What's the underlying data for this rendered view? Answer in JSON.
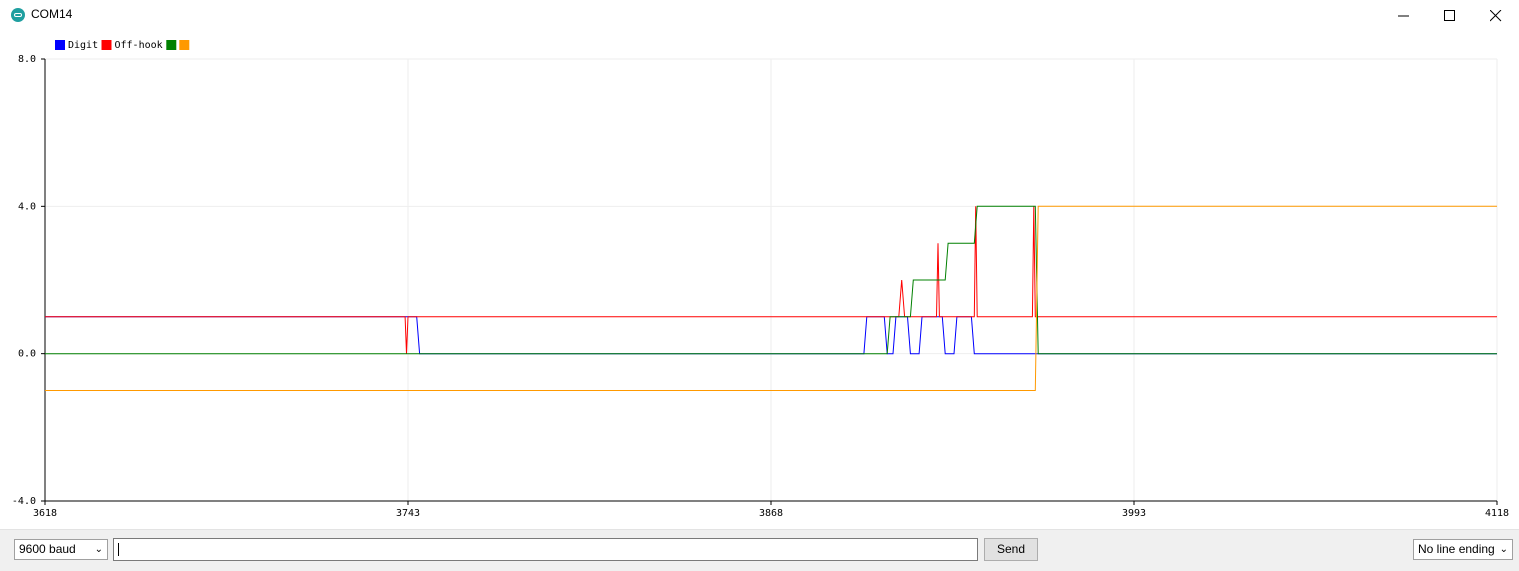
{
  "window": {
    "title": "COM14"
  },
  "chart_data": {
    "type": "line",
    "legend": [
      "Digit",
      "Off-hook",
      "",
      ""
    ],
    "x_ticks": [
      "3618",
      "3743",
      "3868",
      "3993",
      "4118"
    ],
    "y_ticks": [
      "8.0",
      "4.0",
      "0.0",
      "-4.0"
    ],
    "xlim": [
      3618,
      4118
    ],
    "ylim": [
      -4,
      8
    ],
    "grid": true,
    "legend_position": "top-left",
    "series": [
      {
        "name": "Digit",
        "color": "#0000ff",
        "points": [
          [
            3618,
            1
          ],
          [
            3743,
            1
          ],
          [
            3746,
            1
          ],
          [
            3747,
            0
          ],
          [
            3900,
            0
          ],
          [
            3901,
            1
          ],
          [
            3907,
            1
          ],
          [
            3908,
            0
          ],
          [
            3910,
            0
          ],
          [
            3911,
            1
          ],
          [
            3915,
            1
          ],
          [
            3916,
            0
          ],
          [
            3919,
            0
          ],
          [
            3920,
            1
          ],
          [
            3927,
            1
          ],
          [
            3928,
            0
          ],
          [
            3931,
            0
          ],
          [
            3932,
            1
          ],
          [
            3937,
            1
          ],
          [
            3938,
            0
          ],
          [
            4118,
            0
          ]
        ]
      },
      {
        "name": "Off-hook",
        "color": "#ff0000",
        "points": [
          [
            3618,
            1
          ],
          [
            3742,
            1
          ],
          [
            3742.5,
            0
          ],
          [
            3743,
            1
          ],
          [
            3912,
            1
          ],
          [
            3913,
            2
          ],
          [
            3914,
            1
          ],
          [
            3925,
            1
          ],
          [
            3925.5,
            3
          ],
          [
            3926,
            1
          ],
          [
            3938,
            1
          ],
          [
            3938.5,
            4
          ],
          [
            3939,
            1
          ],
          [
            3958,
            1
          ],
          [
            3958.5,
            4
          ],
          [
            3959,
            1
          ],
          [
            4118,
            1
          ]
        ]
      },
      {
        "name": "",
        "color": "#008000",
        "points": [
          [
            3618,
            0
          ],
          [
            3908,
            0
          ],
          [
            3909,
            1
          ],
          [
            3916,
            1
          ],
          [
            3917,
            2
          ],
          [
            3928,
            2
          ],
          [
            3929,
            3
          ],
          [
            3938,
            3
          ],
          [
            3939,
            4
          ],
          [
            3959,
            4
          ],
          [
            3960,
            0
          ],
          [
            4118,
            0
          ]
        ]
      },
      {
        "name": "",
        "color": "#ff9900",
        "points": [
          [
            3618,
            -1
          ],
          [
            3959,
            -1
          ],
          [
            3960,
            4
          ],
          [
            4118,
            4
          ]
        ]
      }
    ]
  },
  "controls": {
    "baud": "9600 baud",
    "input_value": "",
    "send_label": "Send",
    "line_ending": "No line ending"
  }
}
